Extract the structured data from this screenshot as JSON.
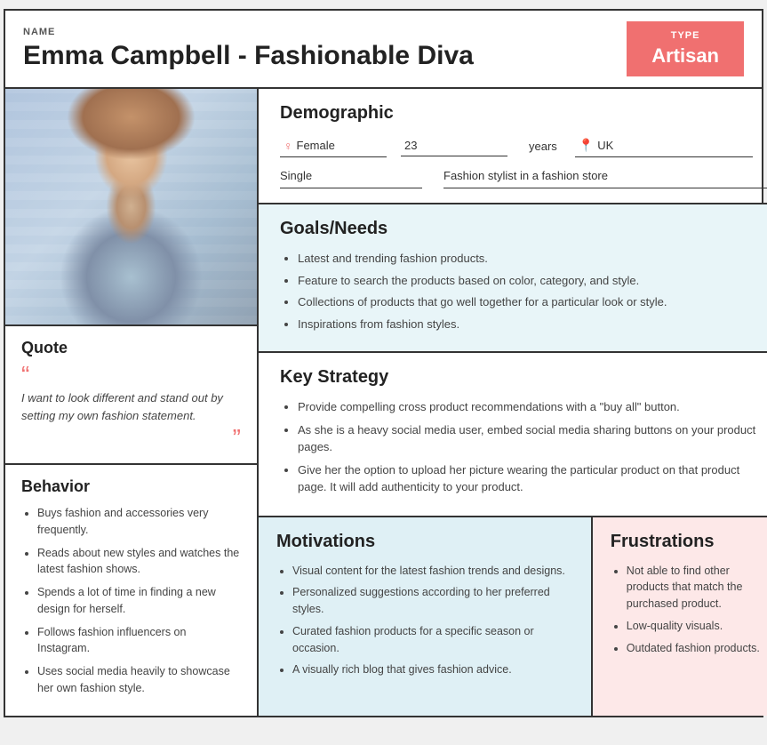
{
  "header": {
    "name_label": "NAME",
    "name": "Emma Campbell - Fashionable Diva",
    "type_label": "TYPE",
    "type_value": "Artisan"
  },
  "demographic": {
    "title": "Demographic",
    "gender": "Female",
    "age": "23",
    "age_unit": "years",
    "location_icon": "📍",
    "location": "UK",
    "relationship": "Single",
    "occupation": "Fashion stylist in a fashion store"
  },
  "quote": {
    "title": "Quote",
    "text": "I want to look different and stand out by setting my own fashion statement."
  },
  "behavior": {
    "title": "Behavior",
    "items": [
      "Buys fashion and accessories very frequently.",
      "Reads about new styles and watches the latest fashion shows.",
      "Spends a lot of time in finding a new design for herself.",
      "Follows fashion influencers on Instagram.",
      "Uses social media heavily to showcase her own fashion style."
    ]
  },
  "goals": {
    "title": "Goals/Needs",
    "items": [
      "Latest and trending fashion products.",
      "Feature to search the products based on color, category, and style.",
      "Collections of products that go well together for a particular look or style.",
      "Inspirations from fashion styles."
    ]
  },
  "strategy": {
    "title": "Key Strategy",
    "items": [
      "Provide compelling cross product recommendations with a \"buy all\" button.",
      "As she is a heavy social media user, embed social media sharing buttons on your product pages.",
      "Give her the option to upload her picture wearing the particular product on that product page. It will add authenticity to your product."
    ]
  },
  "motivations": {
    "title": "Motivations",
    "items": [
      "Visual content for the latest fashion trends and designs.",
      "Personalized suggestions according to her preferred styles.",
      "Curated fashion products for a specific season or occasion.",
      "A visually rich blog that gives fashion advice."
    ]
  },
  "frustrations": {
    "title": "Frustrations",
    "items": [
      "Not able to find other products that match the purchased product.",
      "Low-quality visuals.",
      "Outdated fashion products."
    ]
  }
}
